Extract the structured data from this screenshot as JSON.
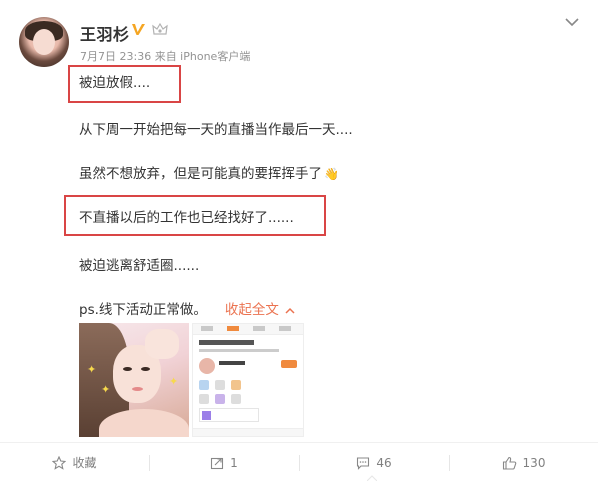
{
  "header": {
    "username": "王羽杉",
    "meta": "7月7日 23:36 来自 iPhone客户端"
  },
  "post": {
    "lines": [
      "被迫放假....",
      "从下周一开始把每一天的直播当作最后一天....",
      "虽然不想放弃，但是可能真的要挥挥手了",
      "不直播以后的工作也已经找好了......",
      "被迫逃离舒适圈......",
      "ps.线下活动正常做。"
    ],
    "collapse_label": "收起全文"
  },
  "footer": {
    "favorite_label": "收藏",
    "repost_count": "1",
    "comment_count": "46",
    "like_count": "130"
  },
  "colors": {
    "accent": "#eb7350",
    "highlight_box": "#d94545",
    "verified": "#f5a623"
  },
  "icons": [
    "verified-badge-icon",
    "crown-icon",
    "chevron-down-icon",
    "waving-hand-icon",
    "chevron-up-icon",
    "star-icon",
    "repost-icon",
    "comment-icon",
    "thumbs-up-icon"
  ]
}
